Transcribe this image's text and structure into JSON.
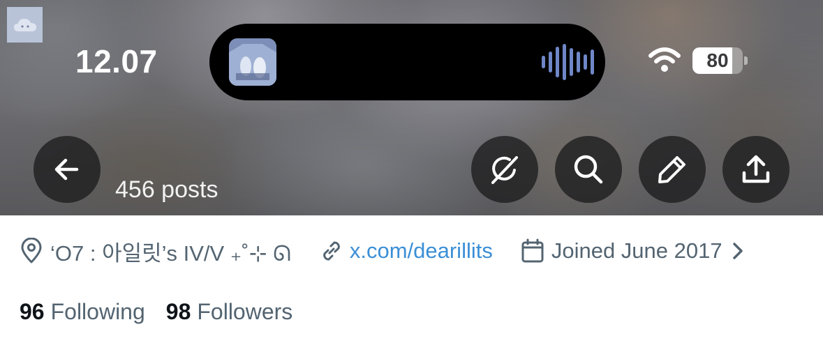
{
  "status_bar": {
    "time": "12.07",
    "battery_level": "80",
    "icons": [
      "wifi-icon",
      "battery-icon"
    ]
  },
  "dynamic_island": {
    "icons": [
      "album-thumbnail",
      "audio-waveform-icon"
    ],
    "accent_color": "#6f86c7"
  },
  "header": {
    "posts_count": "456 posts",
    "buttons": [
      {
        "name": "back-button",
        "icon": "arrow-left-icon"
      },
      {
        "name": "grok-button",
        "icon": "grok-icon"
      },
      {
        "name": "search-button",
        "icon": "search-icon"
      },
      {
        "name": "edit-button",
        "icon": "pencil-icon"
      },
      {
        "name": "share-button",
        "icon": "share-icon"
      }
    ]
  },
  "profile": {
    "location": "‘O7 : 아일릿’s IV/V ₊˚⊹ ᘏ",
    "website": "x.com/dearillits",
    "joined": "Joined June 2017",
    "following_count": "96",
    "following_label": "Following",
    "followers_count": "98",
    "followers_label": "Followers"
  },
  "colors": {
    "link": "#3b8fd6",
    "secondary_text": "#536471",
    "primary_text": "#0f1419"
  }
}
